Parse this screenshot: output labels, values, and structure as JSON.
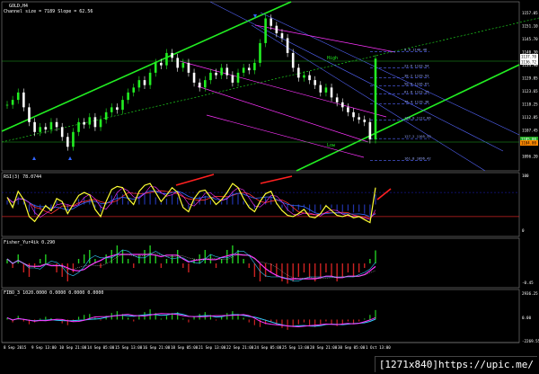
{
  "header": {
    "symbol_label": "GOLD,H4",
    "channel_info": "Channel size = 7189 Slope = 62.56"
  },
  "panes": {
    "rsi_label": "RSI(3) 78.0744",
    "fisher_label": "Fisher_Yur4ik 0.290",
    "fibo_label": "FIBO_3 1020.0000 0.0000 0.0000 0.0000"
  },
  "price_axis": [
    "1157.05",
    "1151.10",
    "1145.70",
    "1140.30",
    "1134.90",
    "1129.05",
    "1123.65",
    "1118.25",
    "1112.85",
    "1107.45",
    "1101.60",
    "1096.20"
  ],
  "price_badges": [
    "1137.70",
    "1136.72",
    "1105.00",
    "1104.00"
  ],
  "rsi_axis": [
    "100",
    "0"
  ],
  "fisher_axis": [
    "",
    "-0.45"
  ],
  "fibo_axis": [
    "2936.25",
    "0.00",
    "-2269.55"
  ],
  "hl_labels": [
    "High",
    "Low"
  ],
  "fib_levels": [
    {
      "label": "0.0  1140.48",
      "value": 1140.48
    },
    {
      "label": "23.6  1133.94",
      "value": 1133.94
    },
    {
      "label": "38.2  1129.93",
      "value": 1129.93
    },
    {
      "label": "50.0  1126.67",
      "value": 1126.67
    },
    {
      "label": "61.8  1123.33",
      "value": 1123.33
    },
    {
      "label": "76.4  1119.38",
      "value": 1119.38
    },
    {
      "label": "100.0  1112.86",
      "value": 1112.86
    },
    {
      "label": "127.2  1105.33",
      "value": 1105.33
    },
    {
      "label": "161.8  1096.42",
      "value": 1096.42
    }
  ],
  "time_axis": [
    "8 Sep 2015",
    "9 Sep 13:00",
    "10 Sep 21:00",
    "14 Sep 05:00",
    "15 Sep 13:00",
    "16 Sep 21:00",
    "18 Sep 05:00",
    "21 Sep 13:00",
    "22 Sep 21:00",
    "24 Sep 05:00",
    "25 Sep 13:00",
    "28 Sep 21:00",
    "30 Sep 05:00",
    "1 Oct 13:00"
  ],
  "watermark": "[1271x840]https://upic.me/",
  "colors": {
    "channel": "#22ee22",
    "bull_candle": "#22ee22",
    "bear_candle": "#ffffff",
    "rsi_main": "#ffff33",
    "fisher_up": "#22cc22",
    "fisher_down": "#cc2222",
    "magenta": "#ff33ff",
    "cyan": "#33ccff",
    "arrow": "#ff2020"
  },
  "chart_data": {
    "type": "line",
    "title": "GOLD,H4",
    "ylim": [
      1093,
      1160
    ],
    "candles_close": [
      1119,
      1121,
      1124,
      1118,
      1112,
      1108,
      1110,
      1109,
      1112,
      1110,
      1106,
      1102,
      1108,
      1112,
      1111,
      1114,
      1110,
      1113,
      1116,
      1118,
      1117,
      1121,
      1124,
      1126,
      1129,
      1127,
      1132,
      1136,
      1135,
      1140,
      1138,
      1134,
      1136,
      1132,
      1128,
      1126,
      1129,
      1132,
      1131,
      1134,
      1131,
      1128,
      1132,
      1134,
      1133,
      1136,
      1144,
      1154,
      1151,
      1148,
      1146,
      1140,
      1134,
      1130,
      1131,
      1129,
      1127,
      1124,
      1126,
      1122,
      1120,
      1118,
      1116,
      1114,
      1113,
      1112,
      1105,
      1137.7
    ],
    "rsi": [
      62,
      45,
      72,
      58,
      30,
      22,
      35,
      48,
      40,
      60,
      55,
      35,
      50,
      65,
      70,
      66,
      42,
      30,
      55,
      75,
      80,
      78,
      60,
      50,
      72,
      82,
      85,
      70,
      55,
      66,
      78,
      70,
      45,
      38,
      60,
      72,
      74,
      62,
      50,
      58,
      70,
      85,
      78,
      60,
      45,
      38,
      55,
      68,
      72,
      52,
      40,
      32,
      30,
      35,
      42,
      30,
      28,
      35,
      48,
      40,
      32,
      30,
      33,
      28,
      30,
      25,
      20,
      78
    ],
    "fisher": [
      0.1,
      -0.1,
      0.2,
      -0.2,
      -0.3,
      -0.1,
      0.1,
      0.2,
      0.0,
      -0.2,
      -0.3,
      -0.4,
      -0.2,
      0.1,
      0.2,
      0.3,
      0.1,
      -0.1,
      0.2,
      0.3,
      0.4,
      0.3,
      0.1,
      -0.1,
      0.2,
      0.3,
      0.4,
      0.2,
      -0.1,
      0.1,
      0.2,
      0.3,
      -0.1,
      -0.2,
      0.1,
      0.2,
      0.3,
      0.2,
      -0.1,
      0.1,
      0.3,
      0.4,
      0.3,
      0.1,
      -0.1,
      -0.3,
      -0.4,
      -0.3,
      -0.2,
      -0.3,
      -0.4,
      -0.45,
      -0.4,
      -0.3,
      -0.2,
      -0.3,
      -0.4,
      -0.3,
      -0.2,
      -0.3,
      -0.4,
      -0.3,
      -0.2,
      -0.3,
      -0.2,
      -0.1,
      0.1,
      0.29
    ],
    "fibo": [
      200,
      -300,
      400,
      -200,
      -500,
      -300,
      100,
      300,
      150,
      -100,
      -400,
      -600,
      -200,
      300,
      500,
      600,
      200,
      -100,
      400,
      700,
      900,
      600,
      200,
      -200,
      500,
      800,
      1100,
      700,
      100,
      400,
      700,
      800,
      100,
      -300,
      300,
      600,
      800,
      500,
      -100,
      300,
      700,
      900,
      600,
      200,
      -300,
      -600,
      -800,
      -500,
      -300,
      -600,
      -900,
      -1100,
      -800,
      -500,
      -300,
      -600,
      -800,
      -500,
      -200,
      -500,
      -700,
      -500,
      -200,
      -400,
      -200,
      100,
      500,
      1020
    ]
  }
}
